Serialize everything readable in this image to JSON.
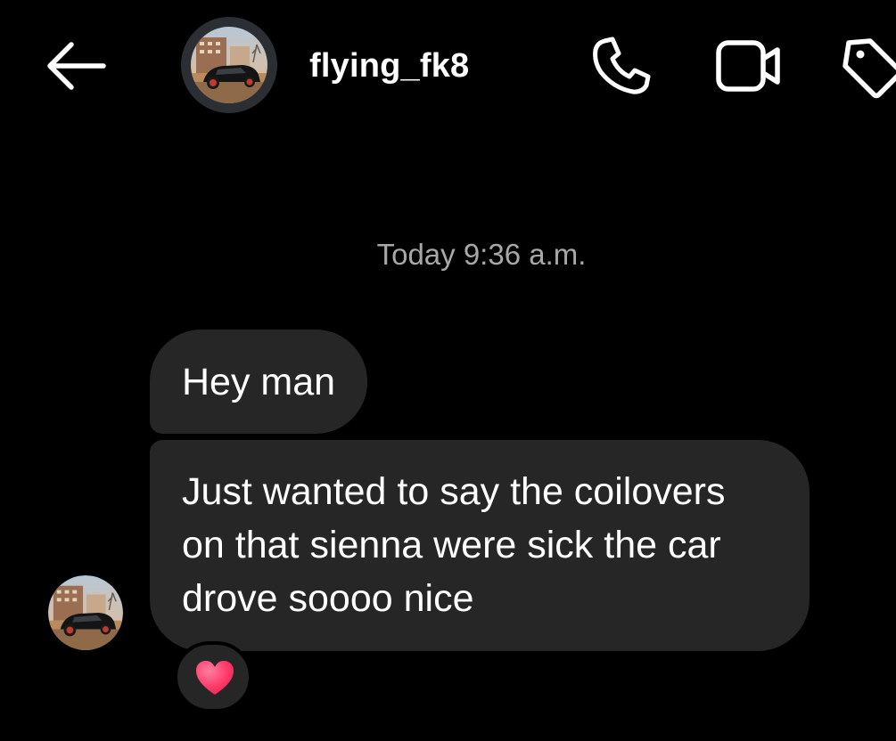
{
  "header": {
    "back_icon": "arrow-left-icon",
    "username": "flying_fk8",
    "actions": [
      {
        "icon": "phone-icon"
      },
      {
        "icon": "video-camera-icon"
      },
      {
        "icon": "tag-icon"
      }
    ]
  },
  "thread": {
    "timestamp": "Today 9:36 a.m.",
    "messages": [
      {
        "text": "Hey man"
      },
      {
        "text": "Just wanted to say the coilovers on that sienna were sick the car drove soooo nice"
      }
    ],
    "reaction": {
      "icon": "red-heart-icon",
      "color": "#ff3b6b"
    }
  },
  "theme": {
    "background": "#000000",
    "bubble": "#262626",
    "muted_text": "#a8a8a8"
  }
}
